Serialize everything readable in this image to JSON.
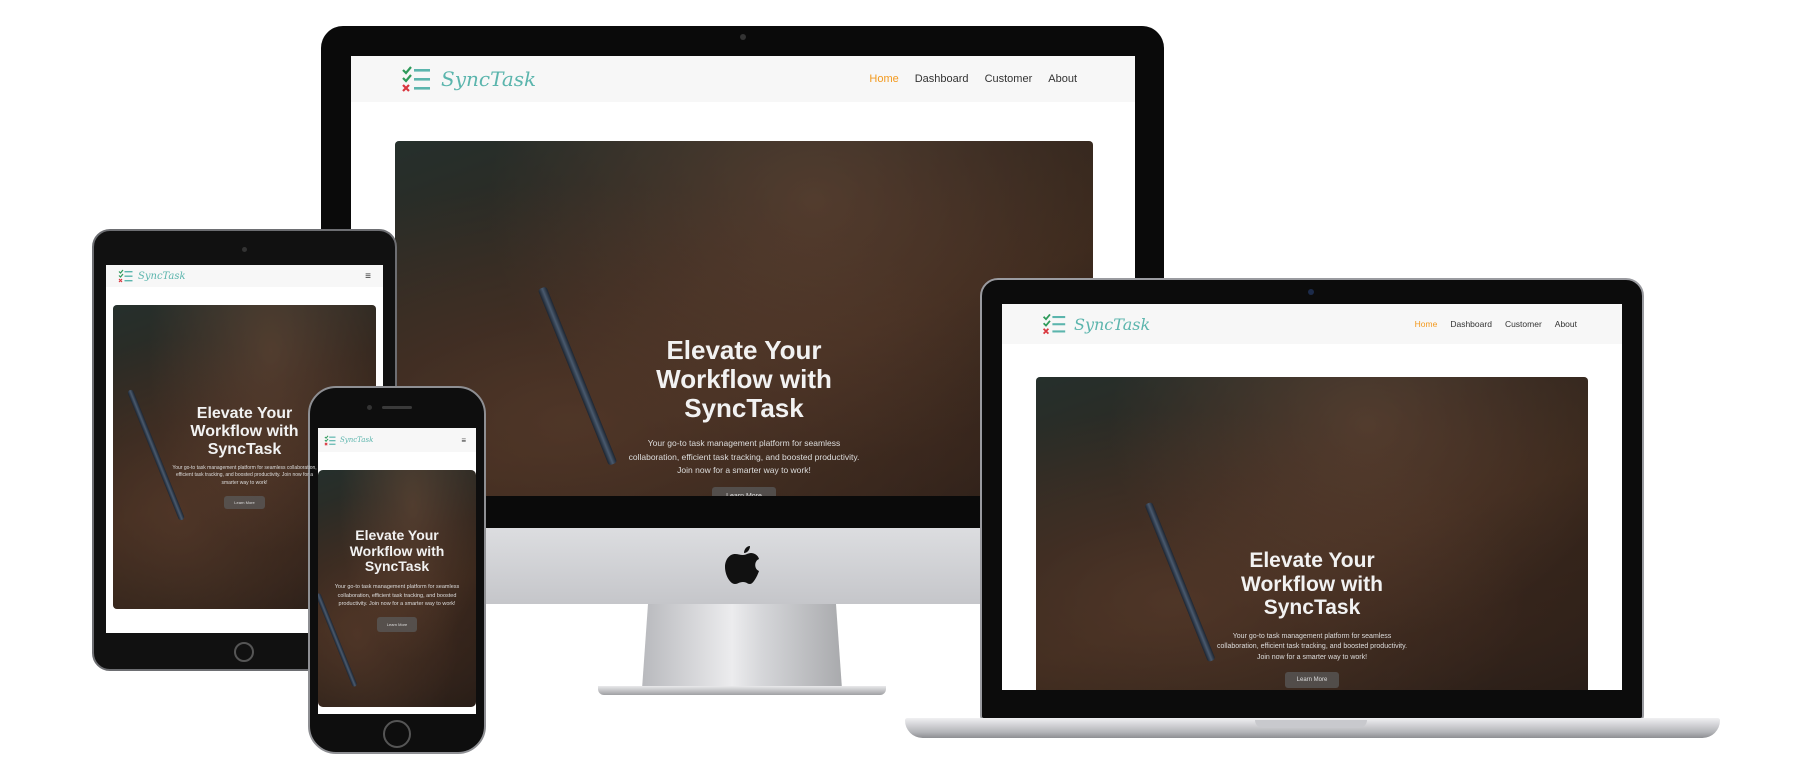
{
  "brand": {
    "name": "SyncTask",
    "logo_icon": "task-checklist-icon",
    "accent_color": "#5bb5ad"
  },
  "nav": {
    "items": [
      {
        "label": "Home",
        "active": true
      },
      {
        "label": "Dashboard",
        "active": false
      },
      {
        "label": "Customer",
        "active": false
      },
      {
        "label": "About",
        "active": false
      }
    ],
    "active_color": "#f39a1f",
    "hamburger": "≡"
  },
  "hero": {
    "title": "Elevate Your Workflow with SyncTask",
    "subtitle": "Your go-to task management platform for seamless collaboration, efficient task tracking, and boosted productivity. Join now for a smarter way to work!",
    "button_label": "Learn More"
  }
}
